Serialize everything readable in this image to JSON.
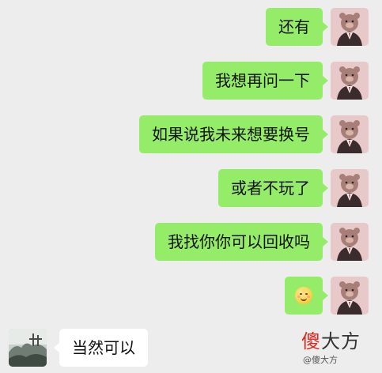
{
  "messages": [
    {
      "side": "out",
      "text": "还有"
    },
    {
      "side": "out",
      "text": "我想再问一下"
    },
    {
      "side": "out",
      "text": "如果说我未来想要换号"
    },
    {
      "side": "out",
      "text": "或者不玩了"
    },
    {
      "side": "out",
      "text": "我找你你可以回收吗"
    },
    {
      "side": "out",
      "emoji": "smiling-blush-emoji"
    },
    {
      "side": "in",
      "text": "当然可以"
    }
  ],
  "watermark": {
    "char1": "傻",
    "char2": "大方",
    "sub": "@傻大方"
  },
  "colors": {
    "background": "#ededed",
    "outgoing_bubble": "#95ec69",
    "incoming_bubble": "#ffffff",
    "watermark_accent": "#e0271c"
  }
}
